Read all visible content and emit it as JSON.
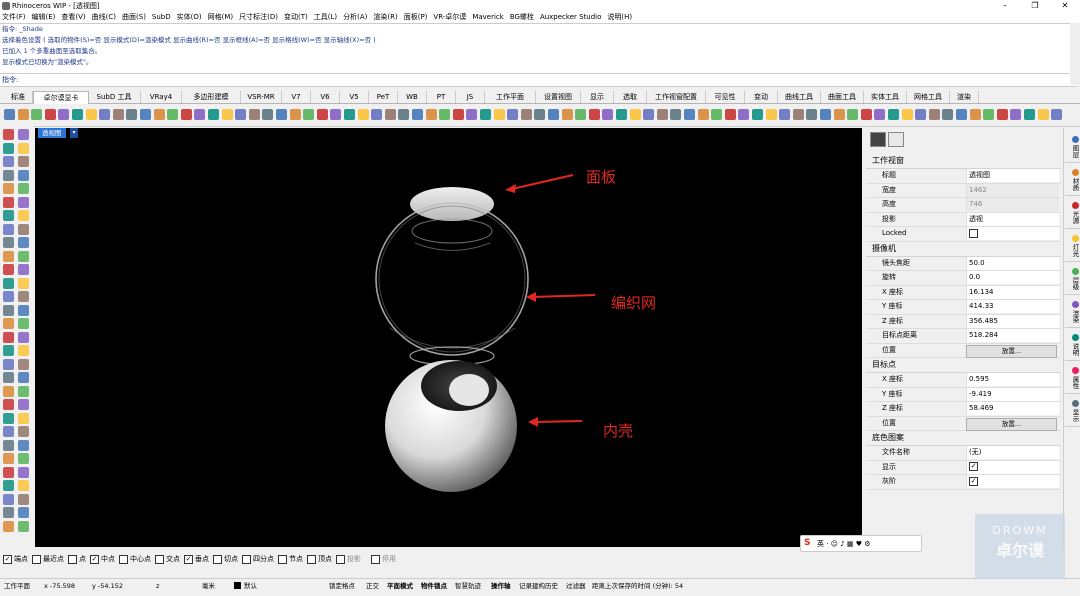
{
  "window": {
    "title": "Rhinoceros WIP - [透视图]",
    "min": "–",
    "max": "❐",
    "close": "✕"
  },
  "menu": [
    "文件(F)",
    "编辑(E)",
    "查看(V)",
    "曲线(C)",
    "曲面(S)",
    "SubD",
    "实体(O)",
    "网格(M)",
    "尺寸标注(D)",
    "变动(T)",
    "工具(L)",
    "分析(A)",
    "渲染(R)",
    "面板(P)",
    "VR-卓尔谟",
    "Maverick",
    "BG螺栓",
    "Auxpecker Studio",
    "说明(H)"
  ],
  "command_history": [
    "指令: _Shade",
    "选择着色设置 ( 选取的物件(S)=否  显示模式(D)=渲染模式  显示曲线(R)=否  显示框线(A)=否  显示格线(W)=否  显示轴线(X)=否 )",
    "已加入 1 个多重曲面至选取集合。",
    "显示模式已切换为\"渲染模式\"。"
  ],
  "command_prompt": "指令:",
  "tabs": [
    "标准",
    "卓尔谟显卡",
    "SubD 工具",
    "VRay4",
    "多边形建模",
    "VSR-MR",
    "V7",
    "V6",
    "V5",
    "PeT",
    "WB",
    "PT",
    "JS",
    "工作平面",
    "设置视图",
    "显示",
    "选取",
    "工作视窗配置",
    "可见性",
    "变动",
    "曲线工具",
    "曲面工具",
    "实体工具",
    "网格工具",
    "渲染"
  ],
  "active_tab": "卓尔谟显卡",
  "viewport": {
    "label": "透视图",
    "annotations": [
      "面板",
      "编织网",
      "内壳"
    ]
  },
  "panel": {
    "section_viewport": "工作视窗",
    "viewport_rows": [
      {
        "k": "标题",
        "v": "透视图"
      },
      {
        "k": "宽度",
        "v": "1462"
      },
      {
        "k": "高度",
        "v": "746"
      },
      {
        "k": "投影",
        "v": "透视"
      },
      {
        "k": "Locked",
        "v": ""
      }
    ],
    "section_camera": "摄像机",
    "camera_rows": [
      {
        "k": "镜头焦距",
        "v": "50.0"
      },
      {
        "k": "旋转",
        "v": "0.0"
      },
      {
        "k": "X 座标",
        "v": "16.134"
      },
      {
        "k": "Y 座标",
        "v": "414.33"
      },
      {
        "k": "Z 座标",
        "v": "356.485"
      },
      {
        "k": "目标点距离",
        "v": "518.284"
      },
      {
        "k": "位置",
        "v": "放置..."
      }
    ],
    "section_target": "目标点",
    "target_rows": [
      {
        "k": "X 座标",
        "v": "0.595"
      },
      {
        "k": "Y 座标",
        "v": "-9.419"
      },
      {
        "k": "Z 座标",
        "v": "58.469"
      },
      {
        "k": "位置",
        "v": "放置..."
      }
    ],
    "section_wallpaper": "底色图案",
    "wallpaper_rows": [
      {
        "k": "文件名称",
        "v": "(无)"
      },
      {
        "k": "显示",
        "v": ""
      },
      {
        "k": "灰阶",
        "v": ""
      }
    ]
  },
  "side_tabs": [
    "图层",
    "材质",
    "光源",
    "灯光",
    "层级",
    "渲染",
    "说明",
    "属性",
    "显示"
  ],
  "osnap": [
    {
      "label": "端点",
      "checked": true
    },
    {
      "label": "最近点",
      "checked": false
    },
    {
      "label": "点",
      "checked": false
    },
    {
      "label": "中点",
      "checked": true
    },
    {
      "label": "中心点",
      "checked": false
    },
    {
      "label": "交点",
      "checked": false
    },
    {
      "label": "垂点",
      "checked": true
    },
    {
      "label": "切点",
      "checked": false
    },
    {
      "label": "四分点",
      "checked": false
    },
    {
      "label": "节点",
      "checked": false
    },
    {
      "label": "顶点",
      "checked": false
    },
    {
      "label": "投影",
      "checked": false
    },
    {
      "label": "停用",
      "checked": false
    }
  ],
  "status": {
    "cplane": "工作平面",
    "x": "x -75.598",
    "y": "y -54.152",
    "z": "z",
    "unit": "毫米",
    "layer": "默认",
    "grid_snap": "锁定格点",
    "ortho": "正交",
    "planar": "平面模式",
    "osnap": "物件锁点",
    "smart": "智慧轨迹",
    "gumball": "操作轴",
    "history": "记录建构历史",
    "filter": "过滤器",
    "saved": "距离上次保存的时间 (分钟): 54"
  },
  "watermark": {
    "top": "DROWM",
    "bottom": "卓尔谟"
  }
}
